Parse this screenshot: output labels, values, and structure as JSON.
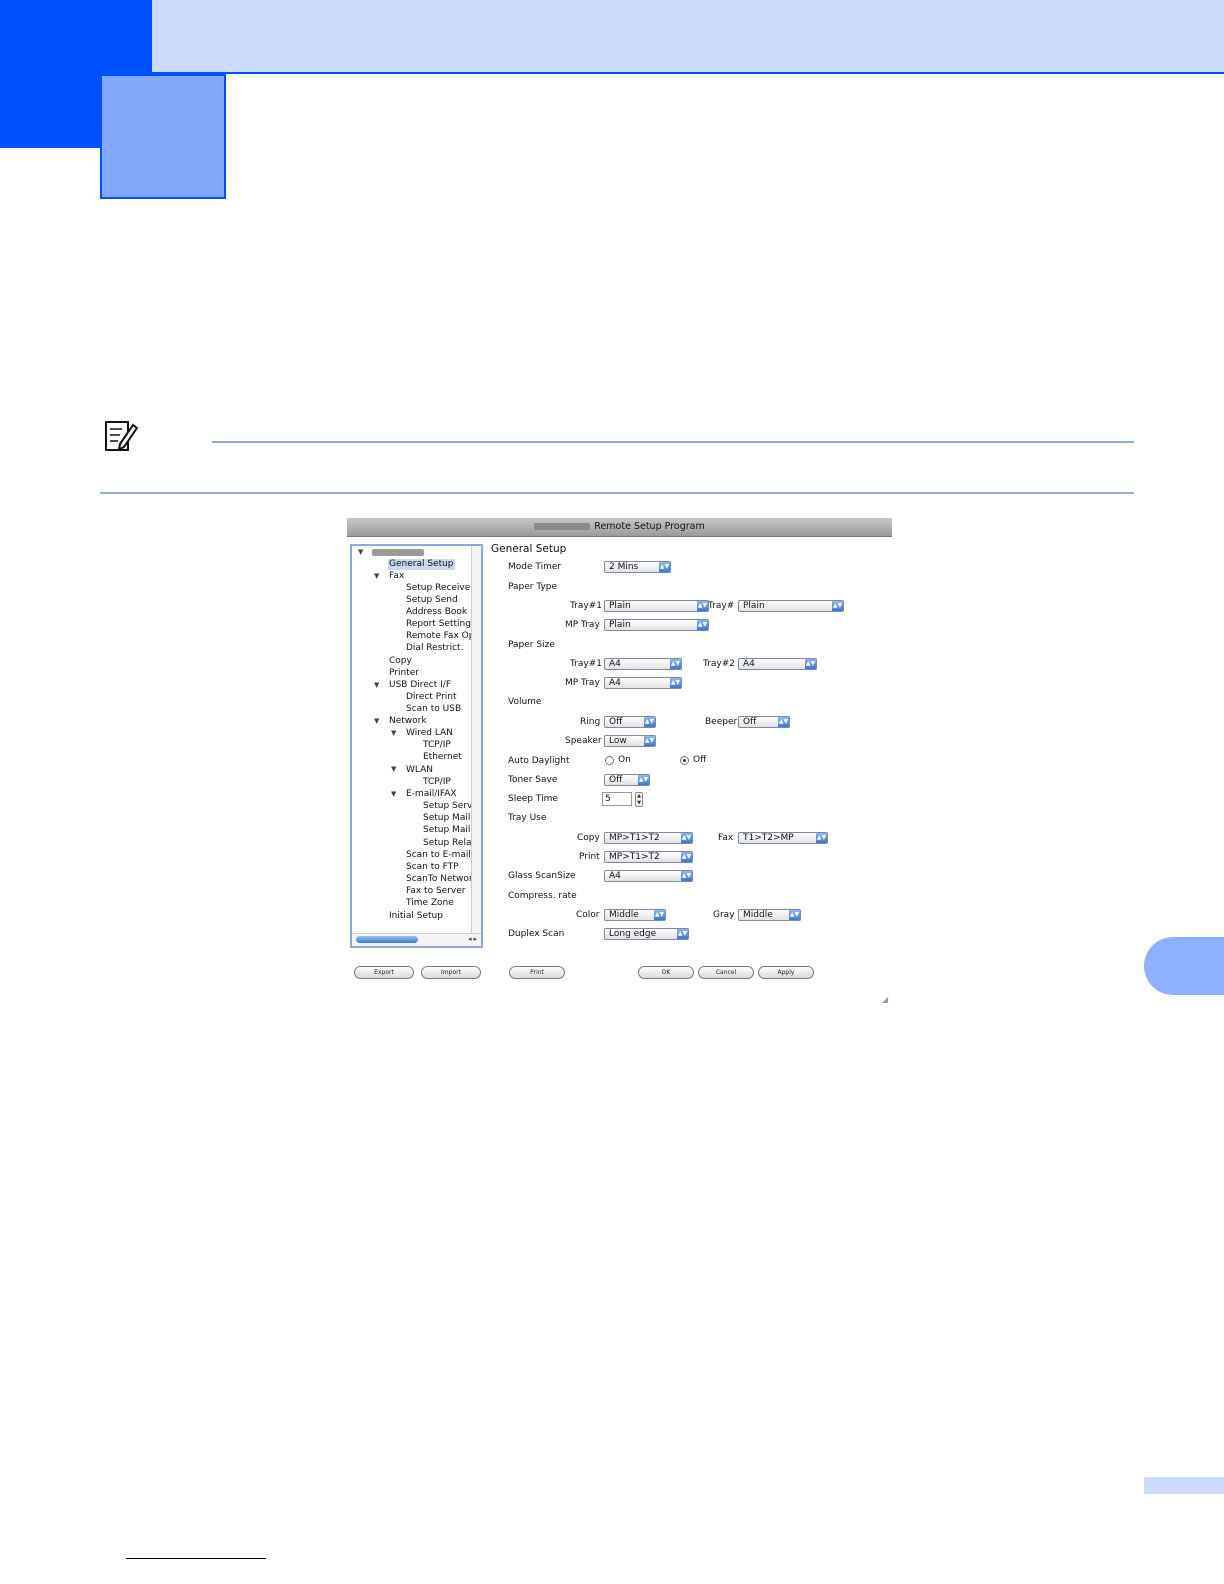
{
  "window": {
    "title": "Remote Setup Program",
    "panel_title": "General Setup"
  },
  "tree": {
    "items": [
      {
        "label": "General Setup"
      },
      {
        "label": "Fax"
      },
      {
        "label": "Setup Receive"
      },
      {
        "label": "Setup Send"
      },
      {
        "label": "Address Book"
      },
      {
        "label": "Report Setting"
      },
      {
        "label": "Remote Fax Opt"
      },
      {
        "label": "Dial Restrict."
      },
      {
        "label": "Copy"
      },
      {
        "label": "Printer"
      },
      {
        "label": "USB Direct I/F"
      },
      {
        "label": "Direct Print"
      },
      {
        "label": "Scan to USB"
      },
      {
        "label": "Network"
      },
      {
        "label": "Wired LAN"
      },
      {
        "label": "TCP/IP"
      },
      {
        "label": "Ethernet"
      },
      {
        "label": "WLAN"
      },
      {
        "label": "TCP/IP"
      },
      {
        "label": "E-mail/IFAX"
      },
      {
        "label": "Setup Serve"
      },
      {
        "label": "Setup Mail R"
      },
      {
        "label": "Setup Mail T"
      },
      {
        "label": "Setup Relay"
      },
      {
        "label": "Scan to E-mail"
      },
      {
        "label": "Scan to FTP"
      },
      {
        "label": "ScanTo Network"
      },
      {
        "label": "Fax to Server"
      },
      {
        "label": "Time Zone"
      },
      {
        "label": "Initial Setup"
      }
    ]
  },
  "labels": {
    "mode_timer": "Mode Timer",
    "paper_type": "Paper Type",
    "tray1": "Tray#1",
    "tray_hash": "Tray#",
    "mp_tray": "MP Tray",
    "paper_size": "Paper Size",
    "tray2": "Tray#2",
    "volume": "Volume",
    "ring": "Ring",
    "beeper": "Beeper",
    "speaker": "Speaker",
    "auto_daylight": "Auto Daylight",
    "on": "On",
    "off": "Off",
    "toner_save": "Toner Save",
    "sleep_time": "Sleep Time",
    "tray_use": "Tray Use",
    "copy": "Copy",
    "fax": "Fax",
    "print": "Print",
    "glass_scansize": "Glass ScanSize",
    "compress_rate": "Compress. rate",
    "color": "Color",
    "gray": "Gray",
    "duplex_scan": "Duplex Scan"
  },
  "values": {
    "mode_timer": "2 Mins",
    "paper_type_tray1": "Plain",
    "paper_type_tray2": "Plain",
    "paper_type_mp": "Plain",
    "paper_size_tray1": "A4",
    "paper_size_tray2": "A4",
    "paper_size_mp": "A4",
    "ring": "Off",
    "beeper": "Off",
    "speaker": "Low",
    "toner_save": "Off",
    "sleep_time": "5",
    "tray_use_copy": "MP>T1>T2",
    "tray_use_fax": "T1>T2>MP",
    "tray_use_print": "MP>T1>T2",
    "glass_scansize": "A4",
    "compress_color": "Middle",
    "compress_gray": "Middle",
    "duplex_scan": "Long edge"
  },
  "buttons": {
    "export": "Export",
    "import": "Import",
    "print": "Print",
    "ok": "OK",
    "cancel": "Cancel",
    "apply": "Apply"
  }
}
